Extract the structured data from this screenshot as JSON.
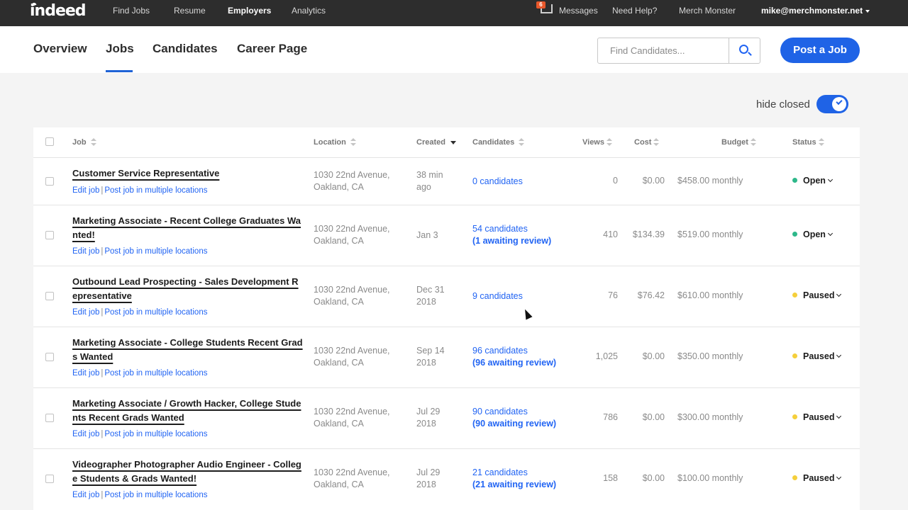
{
  "topbar": {
    "logo": "indeed",
    "nav": [
      "Find Jobs",
      "Resume",
      "Employers",
      "Analytics"
    ],
    "messages_badge": "6",
    "messages": "Messages",
    "help": "Need Help?",
    "company": "Merch Monster",
    "user": "mike@merchmonster.net"
  },
  "subnav": {
    "tabs": [
      "Overview",
      "Jobs",
      "Candidates",
      "Career Page"
    ],
    "active_tab": "Jobs",
    "search_placeholder": "Find Candidates...",
    "post_job": "Post a Job"
  },
  "filters": {
    "hide_closed_label": "hide closed",
    "hide_closed": true
  },
  "table": {
    "columns": [
      "Job",
      "Location",
      "Created",
      "Candidates",
      "Views",
      "Cost",
      "Budget",
      "Status"
    ],
    "edit_link": "Edit job",
    "multi_link": "Post job in multiple locations",
    "rows": [
      {
        "title": "Customer Service Representative",
        "location": "1030 22nd Avenue, Oakland, CA",
        "created": "38 min ago",
        "candidates": "0 candidates",
        "awaiting": "",
        "views": "0",
        "cost": "$0.00",
        "budget": "$458.00 monthly",
        "status": "Open"
      },
      {
        "title": "Marketing Associate - Recent College Graduates Wanted!",
        "location": "1030 22nd Avenue, Oakland, CA",
        "created": "Jan 3",
        "candidates": "54 candidates",
        "awaiting": "(1 awaiting review)",
        "views": "410",
        "cost": "$134.39",
        "budget": "$519.00 monthly",
        "status": "Open"
      },
      {
        "title": "Outbound Lead Prospecting - Sales Development Representative",
        "location": "1030 22nd Avenue, Oakland, CA",
        "created": "Dec 31 2018",
        "candidates": "9 candidates",
        "awaiting": "",
        "views": "76",
        "cost": "$76.42",
        "budget": "$610.00 monthly",
        "status": "Paused"
      },
      {
        "title": "Marketing Associate - College Students Recent Grads Wanted",
        "location": "1030 22nd Avenue, Oakland, CA",
        "created": "Sep 14 2018",
        "candidates": "96 candidates",
        "awaiting": "(96 awaiting review)",
        "views": "1,025",
        "cost": "$0.00",
        "budget": "$350.00 monthly",
        "status": "Paused"
      },
      {
        "title": "Marketing Associate / Growth Hacker, College Students Recent Grads Wanted",
        "location": "1030 22nd Avenue, Oakland, CA",
        "created": "Jul 29 2018",
        "candidates": "90 candidates",
        "awaiting": "(90 awaiting review)",
        "views": "786",
        "cost": "$0.00",
        "budget": "$300.00 monthly",
        "status": "Paused"
      },
      {
        "title": "Videographer Photographer Audio Engineer - College Students & Grads Wanted!",
        "location": "1030 22nd Avenue, Oakland, CA",
        "created": "Jul 29 2018",
        "candidates": "21 candidates",
        "awaiting": "(21 awaiting review)",
        "views": "158",
        "cost": "$0.00",
        "budget": "$100.00 monthly",
        "status": "Paused"
      }
    ]
  },
  "colors": {
    "accent": "#1f63e6",
    "open": "#2eb88a",
    "paused": "#f5cf3b"
  }
}
